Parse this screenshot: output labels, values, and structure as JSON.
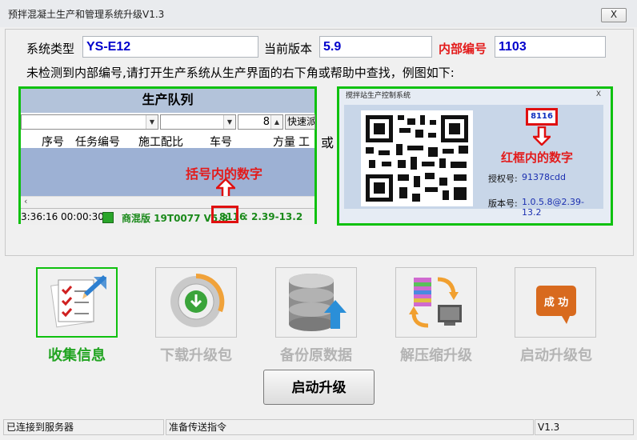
{
  "window": {
    "title": "预拌混凝土生产和管理系统升级V1.3",
    "close_label": "X"
  },
  "form": {
    "type_label": "系统类型",
    "type_value": "YS-E12",
    "version_label": "当前版本",
    "version_value": "5.9",
    "internal_label": "内部编号",
    "internal_value": "1103"
  },
  "note": "未检测到内部编号,请打开生产系统从生产界面的右下角或帮助中查找，例图如下:",
  "or_label": "或",
  "example_left": {
    "queue_title": "生产队列",
    "qty_value": "8",
    "quick_button": "快速派",
    "columns": [
      "序号",
      "任务编号",
      "施工配比",
      "车号",
      "方量",
      "工程"
    ],
    "callout": "括号内的数字",
    "status_time1": "3:36:16",
    "status_time2": "00:00:30",
    "status_text": "商混版 19T0077 V5.8",
    "status_id": "8116",
    "status_tail": ": 2.39-13.2"
  },
  "example_right": {
    "dialog_title": "搅拌站生产控制系统",
    "dialog_close": "X",
    "id_value": "8116",
    "callout": "红框内的数字",
    "auth_label": "授权号:",
    "auth_value": "91378cdd",
    "ver_label": "版本号:",
    "ver_value": "1.0.5.8@2.39-13.2"
  },
  "steps": [
    {
      "label": "收集信息",
      "icon": "checklist-icon",
      "active": true
    },
    {
      "label": "下载升级包",
      "icon": "download-icon",
      "active": false
    },
    {
      "label": "备份原数据",
      "icon": "database-icon",
      "active": false
    },
    {
      "label": "解压缩升级",
      "icon": "unzip-icon",
      "active": false
    },
    {
      "label": "启动升级包",
      "icon": "success-icon",
      "active": false
    }
  ],
  "success_badge": "成 功",
  "start_button": "启动升级",
  "status": {
    "connection": "已连接到服务器",
    "message": "准备传送指令",
    "version": "V1.3"
  },
  "colors": {
    "accent_green": "#21a421",
    "callout_red": "#e31b1b",
    "value_blue": "#0000cc"
  }
}
